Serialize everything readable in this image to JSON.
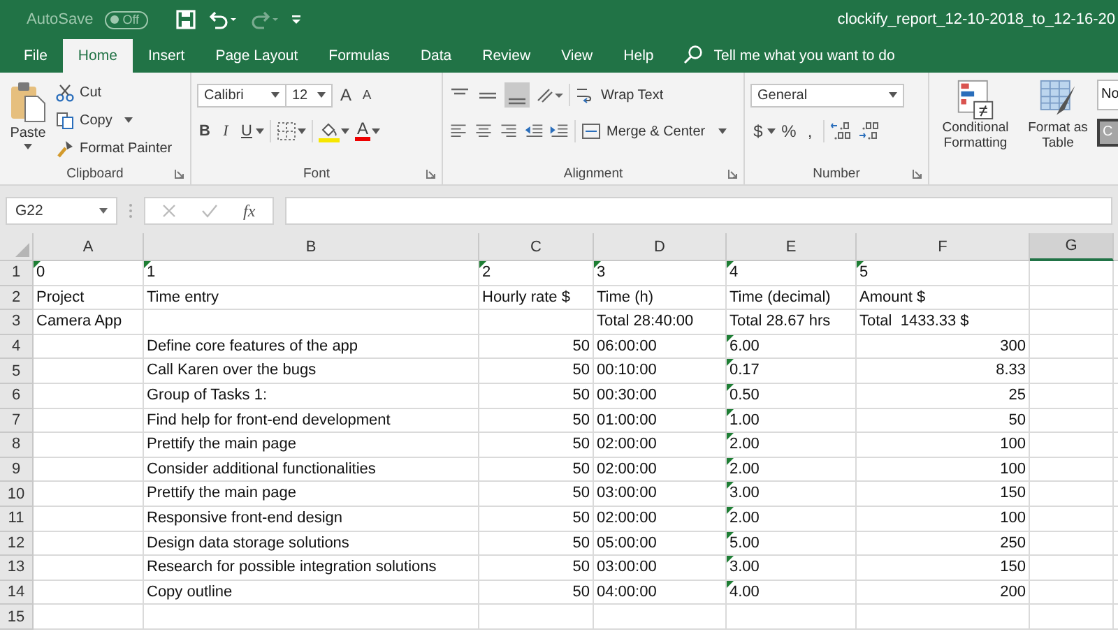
{
  "title_bar": {
    "autosave_label": "AutoSave",
    "autosave_toggle": {
      "label": "Off",
      "on": false
    },
    "redo_disabled": true,
    "title": "clockify_report_12-10-2018_to_12-16-20"
  },
  "menu_tabs": [
    {
      "label": "File",
      "selected": false
    },
    {
      "label": "Home",
      "selected": true
    },
    {
      "label": "Insert",
      "selected": false
    },
    {
      "label": "Page Layout",
      "selected": false
    },
    {
      "label": "Formulas",
      "selected": false
    },
    {
      "label": "Data",
      "selected": false
    },
    {
      "label": "Review",
      "selected": false
    },
    {
      "label": "View",
      "selected": false
    },
    {
      "label": "Help",
      "selected": false
    }
  ],
  "tell_me": "Tell me what you want to do",
  "ribbon": {
    "clipboard": {
      "paste": "Paste",
      "cut": "Cut",
      "copy": "Copy",
      "format_painter": "Format Painter",
      "group_label": "Clipboard"
    },
    "font": {
      "font_name": "Calibri",
      "font_size": "12",
      "grow": "A",
      "shrink": "A",
      "bold": "B",
      "italic": "I",
      "underline": "U",
      "font_color": "A",
      "group_label": "Font"
    },
    "alignment": {
      "wrap_text": "Wrap Text",
      "merge_center": "Merge & Center",
      "group_label": "Alignment"
    },
    "number": {
      "format": "General",
      "currency": "$",
      "percent": "%",
      "comma": ",",
      "group_label": "Number"
    },
    "styles": {
      "conditional_formatting": "Conditional Formatting",
      "format_as_table": "Format as Table",
      "normal_style": "No",
      "check_style": "C"
    }
  },
  "formula_bar": {
    "name_box": "G22",
    "function_label": "fx"
  },
  "sheet": {
    "columns": [
      {
        "label": "A",
        "selected": false
      },
      {
        "label": "B",
        "selected": false
      },
      {
        "label": "C",
        "selected": false
      },
      {
        "label": "D",
        "selected": false
      },
      {
        "label": "E",
        "selected": false
      },
      {
        "label": "F",
        "selected": false
      },
      {
        "label": "G",
        "selected": true
      }
    ],
    "rows": [
      {
        "number": "1",
        "cells": [
          {
            "text": "0",
            "kind": "text",
            "flagged": true
          },
          {
            "text": "1",
            "kind": "text",
            "flagged": true
          },
          {
            "text": "2",
            "kind": "text",
            "flagged": true
          },
          {
            "text": "3",
            "kind": "text",
            "flagged": true
          },
          {
            "text": "4",
            "kind": "text",
            "flagged": true
          },
          {
            "text": "5",
            "kind": "text",
            "flagged": true
          }
        ]
      },
      {
        "number": "2",
        "cells": [
          {
            "text": "Project",
            "kind": "text",
            "flagged": false
          },
          {
            "text": "Time entry",
            "kind": "text",
            "flagged": false
          },
          {
            "text": "Hourly rate $",
            "kind": "text",
            "flagged": false
          },
          {
            "text": "Time (h)",
            "kind": "text",
            "flagged": false
          },
          {
            "text": "Time (decimal)",
            "kind": "text",
            "flagged": false
          },
          {
            "text": "Amount $",
            "kind": "text",
            "flagged": false
          }
        ]
      },
      {
        "number": "3",
        "cells": [
          {
            "text": "Camera App",
            "kind": "text",
            "flagged": false
          },
          {},
          {},
          {
            "text": "Total 28:40:00",
            "kind": "text",
            "flagged": false
          },
          {
            "text": "Total 28.67 hrs",
            "kind": "text",
            "flagged": false
          },
          {
            "text": "Total  1433.33 $",
            "kind": "text",
            "flagged": false
          }
        ]
      },
      {
        "number": "4",
        "cells": [
          {},
          {
            "text": "Define core features of the app",
            "kind": "text",
            "flagged": false
          },
          {
            "text": "50",
            "kind": "number",
            "flagged": false
          },
          {
            "text": "06:00:00",
            "kind": "text",
            "flagged": false
          },
          {
            "text": "6.00",
            "kind": "text",
            "flagged": true
          },
          {
            "text": "300",
            "kind": "number",
            "flagged": false
          }
        ]
      },
      {
        "number": "5",
        "cells": [
          {},
          {
            "text": "Call Karen over the bugs",
            "kind": "text",
            "flagged": false
          },
          {
            "text": "50",
            "kind": "number",
            "flagged": false
          },
          {
            "text": "00:10:00",
            "kind": "text",
            "flagged": false
          },
          {
            "text": "0.17",
            "kind": "text",
            "flagged": true
          },
          {
            "text": "8.33",
            "kind": "number",
            "flagged": false
          }
        ]
      },
      {
        "number": "6",
        "cells": [
          {},
          {
            "text": "Group of Tasks 1:",
            "kind": "text",
            "flagged": false
          },
          {
            "text": "50",
            "kind": "number",
            "flagged": false
          },
          {
            "text": "00:30:00",
            "kind": "text",
            "flagged": false
          },
          {
            "text": "0.50",
            "kind": "text",
            "flagged": true
          },
          {
            "text": "25",
            "kind": "number",
            "flagged": false
          }
        ]
      },
      {
        "number": "7",
        "cells": [
          {},
          {
            "text": "Find help for front-end development",
            "kind": "text",
            "flagged": false
          },
          {
            "text": "50",
            "kind": "number",
            "flagged": false
          },
          {
            "text": "01:00:00",
            "kind": "text",
            "flagged": false
          },
          {
            "text": "1.00",
            "kind": "text",
            "flagged": true
          },
          {
            "text": "50",
            "kind": "number",
            "flagged": false
          }
        ]
      },
      {
        "number": "8",
        "cells": [
          {},
          {
            "text": "Prettify the main page",
            "kind": "text",
            "flagged": false
          },
          {
            "text": "50",
            "kind": "number",
            "flagged": false
          },
          {
            "text": "02:00:00",
            "kind": "text",
            "flagged": false
          },
          {
            "text": "2.00",
            "kind": "text",
            "flagged": true
          },
          {
            "text": "100",
            "kind": "number",
            "flagged": false
          }
        ]
      },
      {
        "number": "9",
        "cells": [
          {},
          {
            "text": "Consider additional functionalities",
            "kind": "text",
            "flagged": false
          },
          {
            "text": "50",
            "kind": "number",
            "flagged": false
          },
          {
            "text": "02:00:00",
            "kind": "text",
            "flagged": false
          },
          {
            "text": "2.00",
            "kind": "text",
            "flagged": true
          },
          {
            "text": "100",
            "kind": "number",
            "flagged": false
          }
        ]
      },
      {
        "number": "10",
        "cells": [
          {},
          {
            "text": "Prettify the main page",
            "kind": "text",
            "flagged": false
          },
          {
            "text": "50",
            "kind": "number",
            "flagged": false
          },
          {
            "text": "03:00:00",
            "kind": "text",
            "flagged": false
          },
          {
            "text": "3.00",
            "kind": "text",
            "flagged": true
          },
          {
            "text": "150",
            "kind": "number",
            "flagged": false
          }
        ]
      },
      {
        "number": "11",
        "cells": [
          {},
          {
            "text": "Responsive front-end design",
            "kind": "text",
            "flagged": false
          },
          {
            "text": "50",
            "kind": "number",
            "flagged": false
          },
          {
            "text": "02:00:00",
            "kind": "text",
            "flagged": false
          },
          {
            "text": "2.00",
            "kind": "text",
            "flagged": true
          },
          {
            "text": "100",
            "kind": "number",
            "flagged": false
          }
        ]
      },
      {
        "number": "12",
        "cells": [
          {},
          {
            "text": "Design data storage solutions",
            "kind": "text",
            "flagged": false
          },
          {
            "text": "50",
            "kind": "number",
            "flagged": false
          },
          {
            "text": "05:00:00",
            "kind": "text",
            "flagged": false
          },
          {
            "text": "5.00",
            "kind": "text",
            "flagged": true
          },
          {
            "text": "250",
            "kind": "number",
            "flagged": false
          }
        ]
      },
      {
        "number": "13",
        "cells": [
          {},
          {
            "text": "Research for possible integration solutions",
            "kind": "text",
            "flagged": false
          },
          {
            "text": "50",
            "kind": "number",
            "flagged": false
          },
          {
            "text": "03:00:00",
            "kind": "text",
            "flagged": false
          },
          {
            "text": "3.00",
            "kind": "text",
            "flagged": true
          },
          {
            "text": "150",
            "kind": "number",
            "flagged": false
          }
        ]
      },
      {
        "number": "14",
        "cells": [
          {},
          {
            "text": "Copy outline",
            "kind": "text",
            "flagged": false
          },
          {
            "text": "50",
            "kind": "number",
            "flagged": false
          },
          {
            "text": "04:00:00",
            "kind": "text",
            "flagged": false
          },
          {
            "text": "4.00",
            "kind": "text",
            "flagged": true
          },
          {
            "text": "200",
            "kind": "number",
            "flagged": false
          }
        ]
      },
      {
        "number": "15",
        "cells": []
      }
    ]
  }
}
